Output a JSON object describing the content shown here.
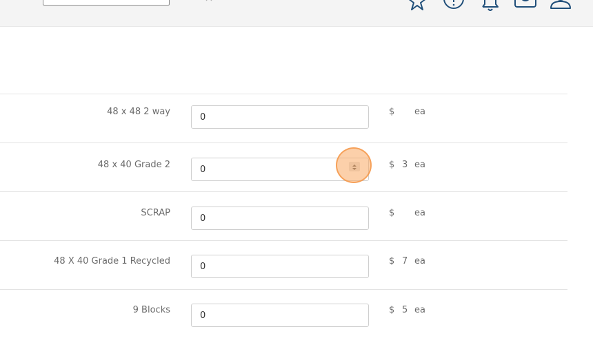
{
  "topbar": {
    "icons": [
      "bookmark-star-icon",
      "info-circle-icon",
      "bell-icon",
      "inbox-icon",
      "user-icon"
    ]
  },
  "rows": [
    {
      "label": "48 x 48 2 way",
      "value": "0",
      "currency": "$",
      "price": "",
      "unit": "ea"
    },
    {
      "label": "48 x 40 Grade 2",
      "value": "0",
      "currency": "$",
      "price": "3",
      "unit": "ea"
    },
    {
      "label": "SCRAP",
      "value": "0",
      "currency": "$",
      "price": "",
      "unit": "ea"
    },
    {
      "label": "48 X 40 Grade 1 Recycled",
      "value": "0",
      "currency": "$",
      "price": "7",
      "unit": "ea"
    },
    {
      "label": "9 Blocks",
      "value": "0",
      "currency": "$",
      "price": "5",
      "unit": "ea"
    }
  ],
  "colors": {
    "icon": "#1f4e79",
    "highlight": "#f7a35c"
  }
}
